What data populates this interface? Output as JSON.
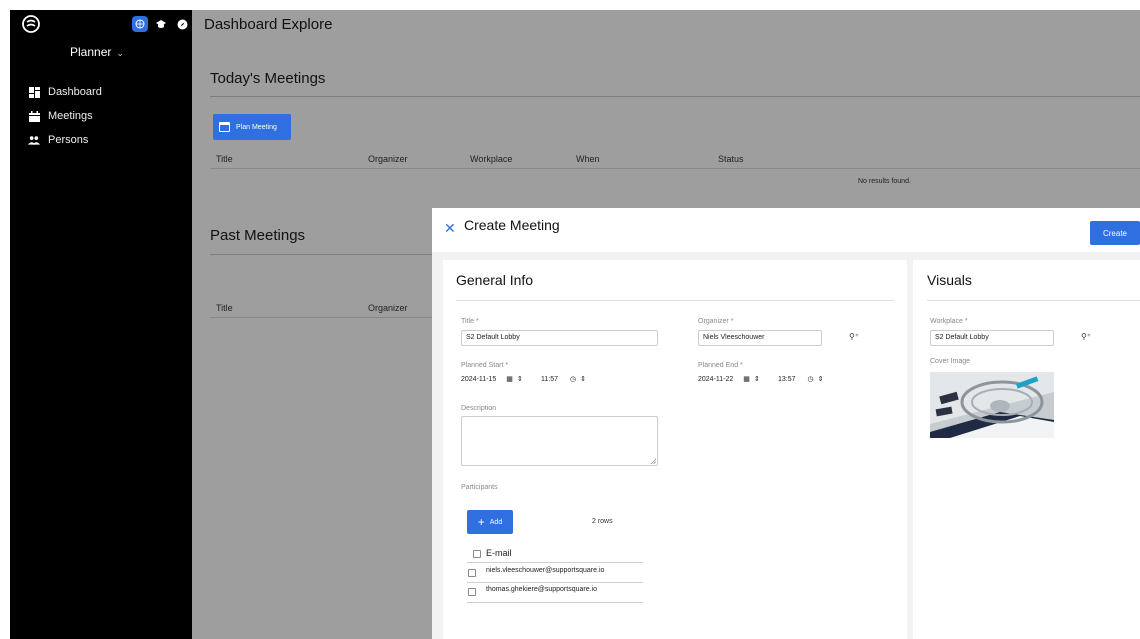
{
  "sidebar": {
    "planner_label": "Planner",
    "nav": [
      {
        "label": "Dashboard",
        "icon": "dashboard-icon"
      },
      {
        "label": "Meetings",
        "icon": "calendar-icon"
      },
      {
        "label": "Persons",
        "icon": "people-icon"
      }
    ],
    "top_icons": [
      "globe-icon",
      "graduation-cap-icon",
      "compass-icon"
    ]
  },
  "header": {
    "title": "Dashboard Explore"
  },
  "today": {
    "title": "Today's Meetings",
    "plan_button": "Plan Meeting",
    "columns": [
      "Title",
      "Organizer",
      "Workplace",
      "When",
      "Status"
    ],
    "empty_text": "No results found."
  },
  "past": {
    "title": "Past Meetings",
    "columns": [
      "Title",
      "Organizer"
    ]
  },
  "modal": {
    "title": "Create Meeting",
    "create_button": "Create",
    "general": {
      "title": "General Info",
      "title_label": "Title *",
      "title_value": "S2 Default Lobby",
      "organizer_label": "Organizer *",
      "organizer_value": "Niels Vleeschouwer",
      "planned_start_label": "Planned Start *",
      "planned_start_date": "2024-11-15",
      "planned_start_time": "11:57",
      "planned_end_label": "Planned End *",
      "planned_end_date": "2024-11-22",
      "planned_end_time": "13:57",
      "description_label": "Description",
      "participants_label": "Participants",
      "add_button": "Add",
      "rows_count": "2 rows",
      "email_header": "E-mail",
      "emails": [
        "niels.vleeschouwer@supportsquare.io",
        "thomas.ghekiere@supportsquare.io"
      ]
    },
    "visuals": {
      "title": "Visuals",
      "workplace_label": "Workplace *",
      "workplace_value": "S2 Default Lobby",
      "cover_label": "Cover Image"
    }
  },
  "colors": {
    "accent": "#2f6fe0",
    "sidebar": "#000000",
    "overlay": "#9e9e9e"
  }
}
